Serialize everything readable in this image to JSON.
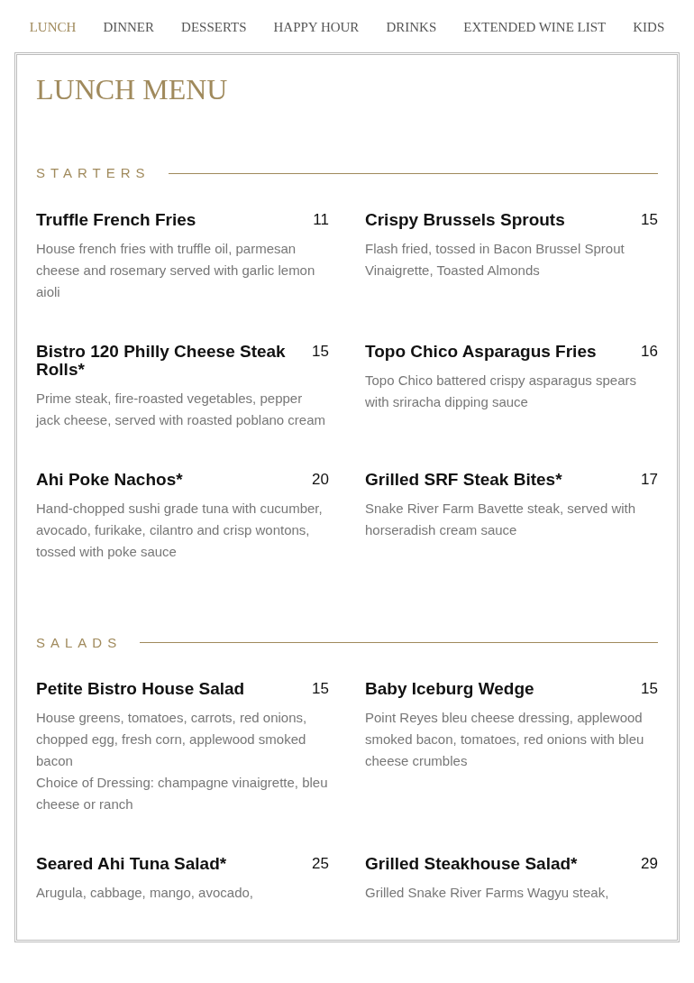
{
  "nav": [
    {
      "label": "LUNCH",
      "selected": true
    },
    {
      "label": "DINNER",
      "selected": false
    },
    {
      "label": "DESSERTS",
      "selected": false
    },
    {
      "label": "HAPPY HOUR",
      "selected": false
    },
    {
      "label": "DRINKS",
      "selected": false
    },
    {
      "label": "EXTENDED WINE LIST",
      "selected": false
    },
    {
      "label": "KIDS",
      "selected": false
    }
  ],
  "title": "LUNCH MENU",
  "sections": [
    {
      "heading": "STARTERS",
      "items": [
        {
          "name": "Truffle French Fries",
          "price": "11",
          "description": [
            "House french fries with truffle oil, parmesan cheese and rosemary served with garlic lemon aioli"
          ]
        },
        {
          "name": "Crispy Brussels Sprouts",
          "price": "15",
          "description": [
            "Flash fried, tossed in Bacon Brussel Sprout Vinaigrette, Toasted Almonds"
          ]
        },
        {
          "name": "Bistro 120 Philly Cheese Steak Rolls*",
          "price": "15",
          "description": [
            "Prime steak, fire-roasted vegetables, pepper jack cheese, served with roasted poblano cream"
          ]
        },
        {
          "name": "Topo Chico Asparagus Fries",
          "price": "16",
          "description": [
            "Topo Chico battered crispy asparagus spears with sriracha dipping sauce"
          ]
        },
        {
          "name": "Ahi Poke Nachos*",
          "price": "20",
          "description": [
            "Hand-chopped sushi grade tuna with cucumber, avocado, furikake, cilantro and crisp wontons, tossed with poke sauce"
          ]
        },
        {
          "name": "Grilled SRF Steak Bites*",
          "price": "17",
          "description": [
            "Snake River Farm Bavette steak, served with horseradish cream sauce"
          ]
        }
      ]
    },
    {
      "heading": "SALADS",
      "items": [
        {
          "name": "Petite Bistro House Salad",
          "price": "15",
          "description": [
            "House greens, tomatoes, carrots, red onions, chopped egg, fresh corn, applewood smoked bacon",
            "Choice of Dressing: champagne vinaigrette, bleu cheese or ranch"
          ]
        },
        {
          "name": "Baby Iceburg Wedge",
          "price": "15",
          "description": [
            "Point Reyes bleu cheese dressing, applewood smoked bacon, tomatoes, red onions with bleu cheese crumbles"
          ]
        },
        {
          "name": "Seared Ahi Tuna Salad*",
          "price": "25",
          "description": [
            "Arugula, cabbage, mango, avocado,"
          ]
        },
        {
          "name": "Grilled Steakhouse Salad*",
          "price": "29",
          "description": [
            "Grilled Snake River Farms Wagyu steak,"
          ]
        }
      ]
    }
  ]
}
